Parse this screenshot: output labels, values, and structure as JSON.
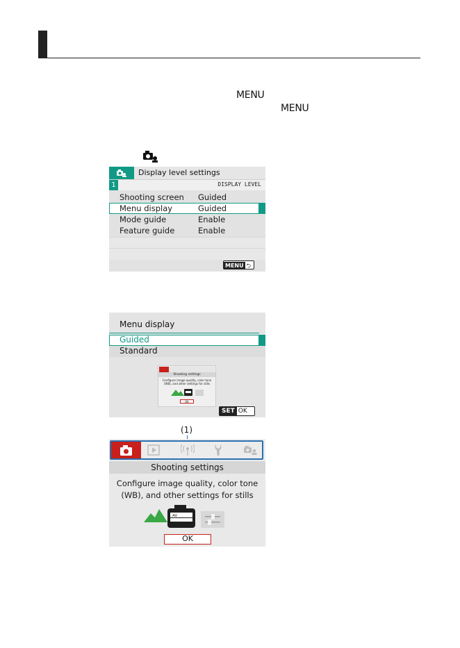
{
  "menu_word": "MENU",
  "screen1": {
    "title": "Display level settings",
    "tab_number": "1",
    "level_label": "DISPLAY LEVEL",
    "rows": [
      {
        "setting": "Shooting screen",
        "value": "Guided"
      },
      {
        "setting": "Menu display",
        "value": "Guided"
      },
      {
        "setting": "Mode guide",
        "value": "Enable"
      },
      {
        "setting": "Feature guide",
        "value": "Enable"
      }
    ],
    "menu_button": "MENU",
    "return_glyph": "⮌"
  },
  "screen2": {
    "title": "Menu display",
    "options": [
      "Guided",
      "Standard"
    ],
    "preview_header": "Shooting settings",
    "preview_desc": "Configure image quality, color tone (WB), and other settings for stills",
    "preview_ok": "OK",
    "set_button": "SET",
    "ok_label": "OK"
  },
  "callout": "(1)",
  "screen3": {
    "header": "Shooting settings",
    "desc_line1": "Configure image quality, color tone",
    "desc_line2": "(WB), and other settings for stills",
    "ok": "OK",
    "av_label": "AV"
  },
  "colors": {
    "teal": "#109a86",
    "red": "#c8201c",
    "blue": "#2a6fb0"
  }
}
